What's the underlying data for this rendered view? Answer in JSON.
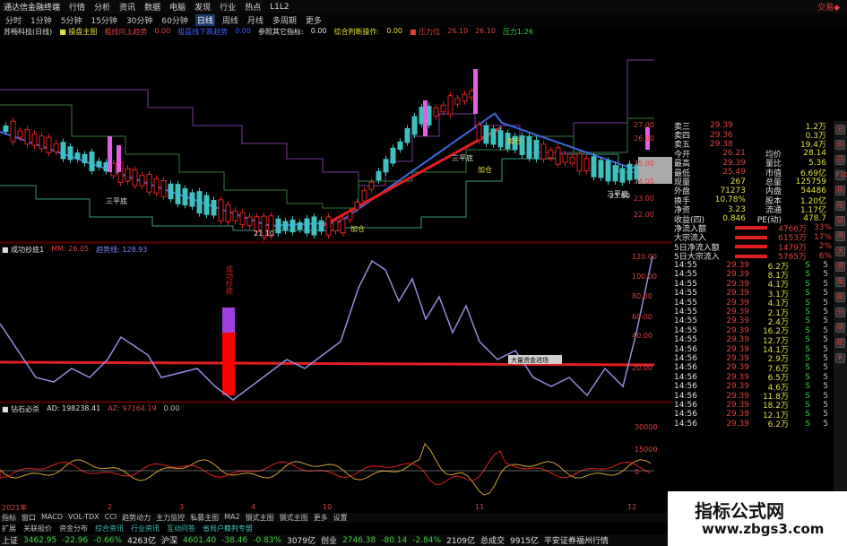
{
  "titlebar": {
    "title": "通达信金融终端",
    "menus": [
      "行情",
      "分析",
      "资讯",
      "数据",
      "电脑",
      "发现",
      "行业",
      "热点",
      "L1L2"
    ],
    "right": "交易◆"
  },
  "tabs": [
    "分时",
    "1分钟",
    "5分钟",
    "15分钟",
    "30分钟",
    "60分钟",
    "日线",
    "周线",
    "月线",
    "多周期",
    "更多"
  ],
  "active_tab": "日线",
  "infobar": [
    {
      "t": "苏畅科技(日线)",
      "c": "#e0e0e0"
    },
    {
      "t": "■ 操盘主图",
      "c": "#e0e040"
    },
    {
      "t": "粗线向上趋势",
      "c": "#e04040"
    },
    {
      "t": "0.00",
      "c": "#e04040"
    },
    {
      "t": "粗蓝线下跌趋势",
      "c": "#4060ff"
    },
    {
      "t": "0.00",
      "c": "#4060ff"
    },
    {
      "t": "参照其它指标:",
      "c": "#e0e0e0"
    },
    {
      "t": "0.00",
      "c": "#e0e0e0"
    },
    {
      "t": "综合判断操作:",
      "c": "#e0e040"
    },
    {
      "t": "0.00",
      "c": "#e0e040"
    },
    {
      "t": "■ 压力位",
      "c": "#e04040"
    },
    {
      "t": "26.10",
      "c": "#e04040"
    },
    {
      "t": "26.10",
      "c": "#e04040"
    },
    {
      "t": "压力1:26",
      "c": "#40d040"
    }
  ],
  "osc1_header": [
    {
      "t": "■ 成功抄底1",
      "c": "#e0e0e0"
    },
    {
      "t": "MM: 26.05",
      "c": "#e04040"
    },
    {
      "t": "趋势线: 128.93",
      "c": "#8080ff"
    }
  ],
  "osc2_header": [
    {
      "t": "■ 钻石必杀",
      "c": "#e0e0e0"
    },
    {
      "t": "AD: 198238.41",
      "c": "#e0e0e0"
    },
    {
      "t": "AZ: 97164.19",
      "c": "#e04040"
    },
    {
      "t": "0.00",
      "c": "#c0c0c0"
    }
  ],
  "chart_labels": {
    "sanping1": "三平底",
    "sanping2": "三平底",
    "sanping3": "三平底",
    "jiacang1": "加仓",
    "jiacang2": "加仓",
    "jiacang3": "加仓",
    "low_price": "21.10",
    "cross_label": "23.60",
    "yaxis_main": [
      "27.00",
      "26.00",
      "25.00",
      "24.00",
      "23.00",
      "22.00"
    ],
    "yaxis_osc1": [
      "120.00",
      "100.00",
      "80.00",
      "60.00",
      "40.00",
      "20.00"
    ],
    "yaxis_osc2": [
      "30000",
      "15000",
      "0"
    ],
    "osc1_vertical_label": "成功抄底",
    "popup": "大量资金进场"
  },
  "right_top": [
    {
      "k": "卖三",
      "v": "29.39",
      "v2": "1.2万"
    },
    {
      "k": "卖四",
      "v": "29.36",
      "v2": "0.3万"
    },
    {
      "k": "卖五",
      "v": "29.38",
      "v2": "19.4万"
    }
  ],
  "right_stats": [
    {
      "k": "今开",
      "v": "26.21",
      "k2": "均价",
      "v2": "28.14"
    },
    {
      "k": "最高",
      "v": "29.39",
      "k2": "量比",
      "v2": "5.36"
    },
    {
      "k": "最低",
      "v": "25.49",
      "k2": "市值",
      "v2": "6.69亿"
    },
    {
      "k": "现量",
      "v": "267",
      "k2": "总量",
      "v2": "125759"
    },
    {
      "k": "外盘",
      "v": "71273",
      "k2": "内盘",
      "v2": "54486"
    },
    {
      "k": "换手",
      "v": "10.78%",
      "k2": "股本",
      "v2": "1.20亿"
    },
    {
      "k": "净资",
      "v": "3.23",
      "k2": "流通",
      "v2": "1.17亿"
    },
    {
      "k": "收益(四)",
      "v": "0.846",
      "k2": "PE(动)",
      "v2": "478.7"
    }
  ],
  "right_flow": [
    {
      "k": "净流入额",
      "v": "4766万",
      "p": "33%"
    },
    {
      "k": "大宗流入",
      "v": "6153万",
      "p": "17%"
    },
    {
      "k": "5日净流入额",
      "v": "1479万",
      "p": "2%"
    },
    {
      "k": "5日大宗流入",
      "v": "5785万",
      "p": "6%"
    }
  ],
  "ticks": [
    [
      "14:55",
      "29.39",
      "6.2万",
      "S",
      "5"
    ],
    [
      "14:55",
      "29.39",
      "8.1万",
      "S",
      "5"
    ],
    [
      "14:55",
      "29.39",
      "4.1万",
      "S",
      "5"
    ],
    [
      "14:55",
      "29.39",
      "3.1万",
      "S",
      "5"
    ],
    [
      "14:55",
      "29.39",
      "4.1万",
      "S",
      "5"
    ],
    [
      "14:55",
      "29.39",
      "2.1万",
      "S",
      "5"
    ],
    [
      "14:55",
      "29.39",
      "2.4万",
      "S",
      "5"
    ],
    [
      "14:55",
      "29.39",
      "16.2万",
      "S",
      "5"
    ],
    [
      "14:55",
      "29.39",
      "12.7万",
      "S",
      "5"
    ],
    [
      "14:56",
      "29.39",
      "14.1万",
      "S",
      "5"
    ],
    [
      "14:56",
      "29.39",
      "2.9万",
      "S",
      "5"
    ],
    [
      "14:56",
      "29.39",
      "7.6万",
      "S",
      "5"
    ],
    [
      "14:56",
      "29.39",
      "6.5万",
      "S",
      "5"
    ],
    [
      "14:56",
      "29.39",
      "4.6万",
      "S",
      "5"
    ],
    [
      "14:56",
      "29.39",
      "11.8万",
      "S",
      "5"
    ],
    [
      "14:56",
      "29.39",
      "18.2万",
      "S",
      "5"
    ],
    [
      "14:56",
      "29.39",
      "12.1万",
      "S",
      "5"
    ],
    [
      "14:56",
      "29.39",
      "6.2万",
      "S",
      "5"
    ]
  ],
  "datebar": [
    "2021年",
    "2",
    "3",
    "4",
    "10",
    "11",
    "12"
  ],
  "bottomtabs": [
    "指标",
    "窗口",
    "MACD",
    "VOL-TDX",
    "CCI",
    "趋势动力",
    "主力监控",
    "私募主图",
    "MA2",
    "钢式主图",
    "钢式主图",
    "更多",
    "设置"
  ],
  "statusbar2": [
    "扩展",
    "关联报价",
    "资金分布",
    "综合资讯",
    "行业资讯",
    "互动问答",
    "省局户籍判专盟"
  ],
  "status": [
    {
      "t": "上证",
      "c": "#e0e0e0"
    },
    {
      "t": "3462.95",
      "c": "#40d040"
    },
    {
      "t": "-22.96",
      "c": "#40d040"
    },
    {
      "t": "-0.66%",
      "c": "#40d040"
    },
    {
      "t": "4263亿",
      "c": "#e0e0e0"
    },
    {
      "t": "沪深",
      "c": "#e0e0e0"
    },
    {
      "t": "4601.40",
      "c": "#40d040"
    },
    {
      "t": "-38.46",
      "c": "#40d040"
    },
    {
      "t": "-0.83%",
      "c": "#40d040"
    },
    {
      "t": "3079亿",
      "c": "#e0e0e0"
    },
    {
      "t": "创业",
      "c": "#e0e0e0"
    },
    {
      "t": "2746.38",
      "c": "#40d040"
    },
    {
      "t": "-80.14",
      "c": "#40d040"
    },
    {
      "t": "-2.84%",
      "c": "#40d040"
    },
    {
      "t": "2109亿",
      "c": "#e0e0e0"
    },
    {
      "t": "总成交",
      "c": "#e0e0e0"
    },
    {
      "t": "9915亿",
      "c": "#e0e0e0"
    },
    {
      "t": "平安证券福州行情",
      "c": "#e0e0e0"
    }
  ],
  "watermark": {
    "line1": "指标公式网",
    "line2": "www.zbgs3.com"
  },
  "side_icons": [
    "分",
    "价",
    "日",
    "F10",
    "板",
    "陆",
    "研",
    "牌",
    "大",
    "资",
    "版",
    "投",
    "分",
    "研",
    "统",
    "R"
  ]
}
